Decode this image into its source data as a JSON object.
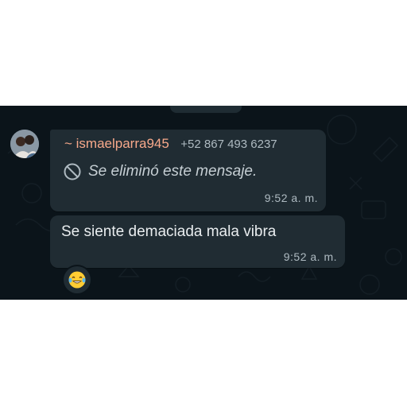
{
  "message_group": {
    "sender": {
      "name": "~ ismaelparra945",
      "phone": "+52 867 493 6237"
    },
    "messages": [
      {
        "deleted": true,
        "text": "Se eliminó este mensaje.",
        "time": "9:52 a. m.",
        "icon": "ban-icon"
      },
      {
        "deleted": false,
        "text": "Se siente demaciada mala vibra",
        "time": "9:52 a. m.",
        "reaction": "laughing-tears-emoji"
      }
    ]
  },
  "colors": {
    "chat_background": "#0b141a",
    "bubble": "#202c33",
    "sender_name": "#f7a98b",
    "text": "#e9edef",
    "meta": "#aebac1"
  }
}
